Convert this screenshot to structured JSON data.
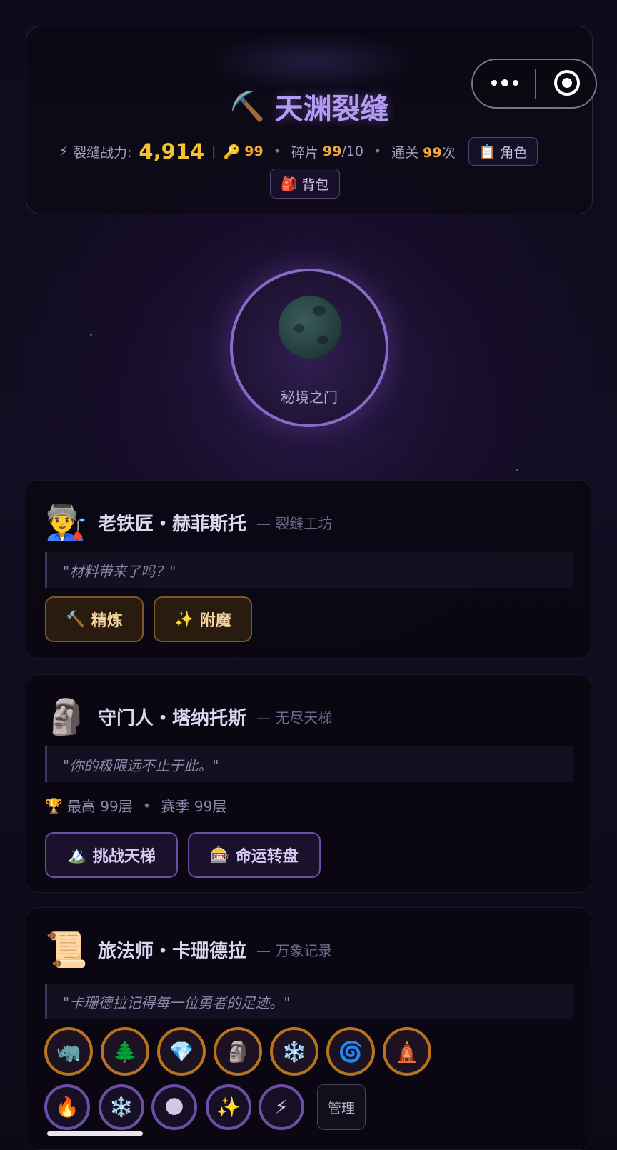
{
  "header": {
    "title_icon": "⛏️",
    "title": "天渊裂缝",
    "power_icon": "⚡",
    "power_label": "裂缝战力:",
    "power_value": "4,914",
    "separator": "|",
    "key_icon": "🔑",
    "keys": "99",
    "shard_label": "碎片",
    "shards": "99",
    "shard_max": "/10",
    "clear_label": "通关",
    "clears": "99",
    "clear_unit": "次",
    "role_icon": "📋",
    "role_button": "角色",
    "bag_icon": "🎒",
    "bag_button": "背包"
  },
  "capsule": {
    "more_icon": "more-dots-icon",
    "close_icon": "target-icon"
  },
  "portal": {
    "icon": "🌑",
    "label": "秘境之门"
  },
  "npcs": [
    {
      "avatar": "👨‍🏭",
      "name": "老铁匠・赫菲斯托",
      "role": "— 裂缝工坊",
      "quote": "\"材料带来了吗？\"",
      "buttons": [
        {
          "icon": "🔨",
          "label": "精炼"
        },
        {
          "icon": "✨",
          "label": "附魔"
        }
      ]
    },
    {
      "avatar": "🗿",
      "name": "守门人・塔纳托斯",
      "role": "— 无尽天梯",
      "quote": "\"你的极限远不止于此。\"",
      "info_icon": "🏆",
      "info_best": "最高 99层",
      "info_season": "赛季 99层",
      "buttons": [
        {
          "icon": "🏔️",
          "label": "挑战天梯"
        },
        {
          "icon": "🎰",
          "label": "命运转盘"
        }
      ]
    },
    {
      "avatar": "📜",
      "name": "旅法师・卡珊德拉",
      "role": "— 万象记录",
      "quote": "\"卡珊德拉记得每一位勇者的足迹。\"",
      "relics": [
        "🦏",
        "🌲",
        "💎",
        "🗿",
        "❄️",
        "🌀",
        "🛕"
      ],
      "elements": [
        "🔥",
        "❄️",
        "🌑",
        "✨",
        "⚡"
      ],
      "manage_label": "管理"
    }
  ]
}
